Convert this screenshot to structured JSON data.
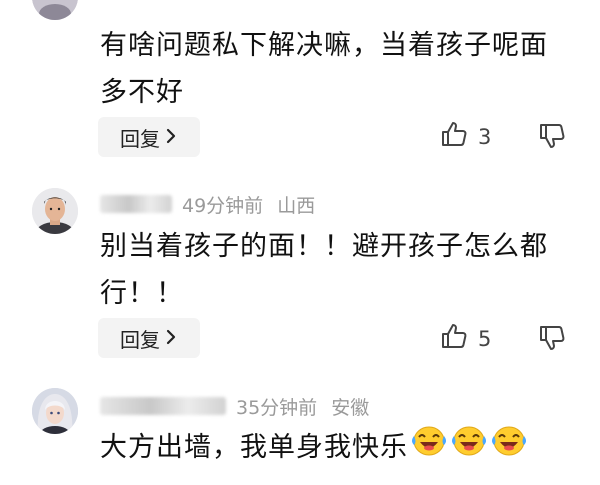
{
  "comments": [
    {
      "text": "有啥问题私下解决嘛，当着孩子呢面多不好",
      "reply_label": "回复",
      "like_count": "3"
    },
    {
      "time": "49分钟前",
      "location": "山西",
      "text": "别当着孩子的面！！避开孩子怎么都行！！",
      "reply_label": "回复",
      "like_count": "5"
    },
    {
      "time": "35分钟前",
      "location": "安徽",
      "text": "大方出墙，我单身我快乐"
    }
  ],
  "icons": {
    "like": "thumbs-up-icon",
    "dislike": "thumbs-down-icon",
    "chevron": "chevron-right-icon",
    "emoji": "laughing-crying-emoji-icon"
  },
  "colors": {
    "meta_text": "#9a9a9a",
    "reply_bg": "#f3f3f3"
  }
}
